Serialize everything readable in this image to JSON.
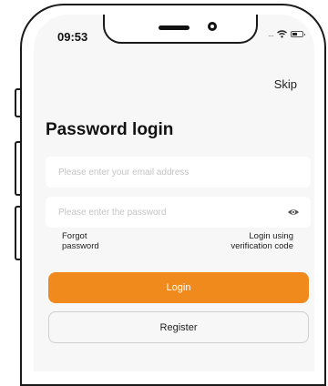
{
  "status_bar": {
    "time": "09:53",
    "signal_dots": "....",
    "icons": [
      "wifi-icon",
      "battery-icon"
    ]
  },
  "header": {
    "skip_label": "Skip"
  },
  "login": {
    "title": "Password login",
    "email_placeholder": "Please enter your email address",
    "password_placeholder": "Please enter the password",
    "forgot_line1": "Forgot",
    "forgot_line2": "password",
    "verification_line1": "Login using",
    "verification_line2": "verification code",
    "login_label": "Login",
    "register_label": "Register"
  },
  "colors": {
    "accent": "#f08a1c",
    "screen_bg": "#f7f7f7",
    "field_bg": "#ffffff"
  }
}
